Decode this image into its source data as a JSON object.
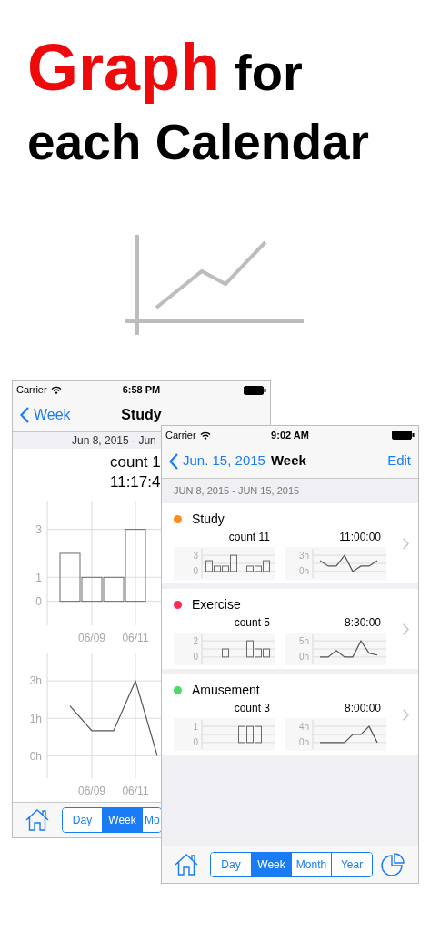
{
  "headline": {
    "lines": [
      [
        {
          "text": "Graph",
          "highlighted": true
        },
        {
          "text": "for",
          "highlighted": false
        }
      ],
      [
        {
          "text": "each Calendar",
          "highlighted": false
        }
      ]
    ]
  },
  "back_screen": {
    "status_bar": {
      "carrier": "Carrier",
      "time": "6:58 PM"
    },
    "nav": {
      "back": "Week",
      "title": "Study"
    },
    "date_range": "Jun 8, 2015 - Jun",
    "count": "count 1",
    "duration": "11:17:4",
    "count_chart": {
      "chart_data": {
        "type": "bar",
        "grid": true,
        "categories": [
          null,
          "06/09",
          null,
          "06/11",
          null
        ],
        "yticks": [
          0,
          1,
          3
        ],
        "ylim": [
          -1,
          4.2
        ],
        "values": [
          2,
          1,
          1,
          3,
          0
        ]
      }
    },
    "time_chart": {
      "chart_data": {
        "type": "line",
        "grid": true,
        "categories": [
          null,
          "06/09",
          null,
          "06/11",
          null
        ],
        "yticks": [
          {
            "value": 0,
            "label": "0h"
          },
          {
            "value": 1.5,
            "label": "1h"
          },
          {
            "value": 3,
            "label": "3h"
          }
        ],
        "ylim": [
          -0.9,
          4.1
        ],
        "values": [
          2,
          1,
          1,
          3,
          0
        ]
      }
    },
    "segments": [
      {
        "label": "Day",
        "selected": false
      },
      {
        "label": "Week",
        "selected": true
      },
      {
        "label": "Mo",
        "selected": false
      }
    ]
  },
  "front_screen": {
    "status_bar": {
      "carrier": "Carrier",
      "time": "9:02 AM"
    },
    "nav": {
      "back": "Jun. 15, 2015",
      "title": "Week",
      "action": "Edit"
    },
    "section_header": "JUN 8, 2015 - JUN 15, 2015",
    "calendars": [
      {
        "name": "Study",
        "color": "#ff8c1a",
        "count": "count 11",
        "duration": "11:00:00",
        "count_chart": {
          "chart_data": {
            "type": "bar",
            "yticks": [
              0,
              3
            ],
            "ylim": [
              -1.2,
              4.2
            ],
            "values": [
              2,
              1,
              1,
              3,
              0,
              1,
              1,
              2
            ]
          }
        },
        "time_chart": {
          "chart_data": {
            "type": "line",
            "yticks": [
              {
                "value": 0,
                "label": "0h"
              },
              {
                "value": 3,
                "label": "3h"
              }
            ],
            "ylim": [
              -1.2,
              4.2
            ],
            "values": [
              2,
              1,
              1,
              3,
              0,
              1,
              1,
              2
            ]
          }
        }
      },
      {
        "name": "Exercise",
        "color": "#ff2d55",
        "count": "count 5",
        "duration": "8:30:00",
        "count_chart": {
          "chart_data": {
            "type": "bar",
            "yticks": [
              0,
              2
            ],
            "ylim": [
              -0.8,
              2.8
            ],
            "values": [
              0,
              0,
              1,
              0,
              0,
              2,
              1,
              1
            ]
          }
        },
        "time_chart": {
          "chart_data": {
            "type": "line",
            "yticks": [
              {
                "value": 0,
                "label": "0h"
              },
              {
                "value": 5,
                "label": "5h"
              }
            ],
            "ylim": [
              -2,
              7
            ],
            "values": [
              0,
              0,
              2,
              0,
              0,
              5,
              1.2,
              0.6
            ]
          }
        }
      },
      {
        "name": "Amusement",
        "color": "#4cd964",
        "count": "count 3",
        "duration": "8:00:00",
        "count_chart": {
          "chart_data": {
            "type": "bar",
            "yticks": [
              0,
              1
            ],
            "ylim": [
              -0.4,
              1.4
            ],
            "values": [
              0,
              0,
              0,
              0,
              1,
              1,
              1,
              0
            ]
          }
        },
        "time_chart": {
          "chart_data": {
            "type": "line",
            "yticks": [
              {
                "value": 0,
                "label": "0h"
              },
              {
                "value": 4,
                "label": "4h"
              }
            ],
            "ylim": [
              -1.6,
              5.6
            ],
            "values": [
              0,
              0,
              0,
              0,
              2,
              2,
              4,
              0
            ]
          }
        }
      }
    ],
    "segments": [
      {
        "label": "Day",
        "selected": false
      },
      {
        "label": "Week",
        "selected": true
      },
      {
        "label": "Month",
        "selected": false
      },
      {
        "label": "Year",
        "selected": false
      }
    ]
  }
}
